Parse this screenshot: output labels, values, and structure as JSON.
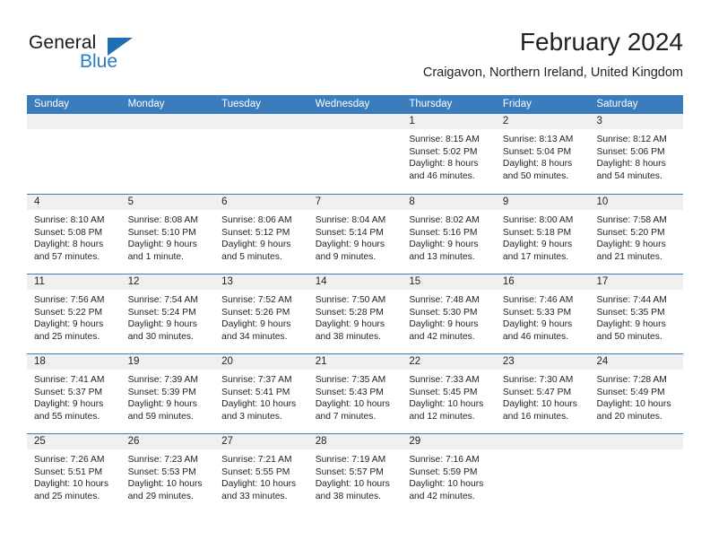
{
  "brand": {
    "name_top": "General",
    "name_bottom": "Blue",
    "accent_color": "#2b7cc4",
    "triangle_color": "#1f6fb5"
  },
  "header": {
    "month_title": "February 2024",
    "location": "Craigavon, Northern Ireland, United Kingdom"
  },
  "calendar": {
    "header_color": "#3b7cbd",
    "daynum_band_color": "#f0f0f0",
    "weekdays": [
      "Sunday",
      "Monday",
      "Tuesday",
      "Wednesday",
      "Thursday",
      "Friday",
      "Saturday"
    ],
    "weeks": [
      [
        {
          "day": "",
          "sunrise": "",
          "sunset": "",
          "daylight_line1": "",
          "daylight_line2": ""
        },
        {
          "day": "",
          "sunrise": "",
          "sunset": "",
          "daylight_line1": "",
          "daylight_line2": ""
        },
        {
          "day": "",
          "sunrise": "",
          "sunset": "",
          "daylight_line1": "",
          "daylight_line2": ""
        },
        {
          "day": "",
          "sunrise": "",
          "sunset": "",
          "daylight_line1": "",
          "daylight_line2": ""
        },
        {
          "day": "1",
          "sunrise": "Sunrise: 8:15 AM",
          "sunset": "Sunset: 5:02 PM",
          "daylight_line1": "Daylight: 8 hours",
          "daylight_line2": "and 46 minutes."
        },
        {
          "day": "2",
          "sunrise": "Sunrise: 8:13 AM",
          "sunset": "Sunset: 5:04 PM",
          "daylight_line1": "Daylight: 8 hours",
          "daylight_line2": "and 50 minutes."
        },
        {
          "day": "3",
          "sunrise": "Sunrise: 8:12 AM",
          "sunset": "Sunset: 5:06 PM",
          "daylight_line1": "Daylight: 8 hours",
          "daylight_line2": "and 54 minutes."
        }
      ],
      [
        {
          "day": "4",
          "sunrise": "Sunrise: 8:10 AM",
          "sunset": "Sunset: 5:08 PM",
          "daylight_line1": "Daylight: 8 hours",
          "daylight_line2": "and 57 minutes."
        },
        {
          "day": "5",
          "sunrise": "Sunrise: 8:08 AM",
          "sunset": "Sunset: 5:10 PM",
          "daylight_line1": "Daylight: 9 hours",
          "daylight_line2": "and 1 minute."
        },
        {
          "day": "6",
          "sunrise": "Sunrise: 8:06 AM",
          "sunset": "Sunset: 5:12 PM",
          "daylight_line1": "Daylight: 9 hours",
          "daylight_line2": "and 5 minutes."
        },
        {
          "day": "7",
          "sunrise": "Sunrise: 8:04 AM",
          "sunset": "Sunset: 5:14 PM",
          "daylight_line1": "Daylight: 9 hours",
          "daylight_line2": "and 9 minutes."
        },
        {
          "day": "8",
          "sunrise": "Sunrise: 8:02 AM",
          "sunset": "Sunset: 5:16 PM",
          "daylight_line1": "Daylight: 9 hours",
          "daylight_line2": "and 13 minutes."
        },
        {
          "day": "9",
          "sunrise": "Sunrise: 8:00 AM",
          "sunset": "Sunset: 5:18 PM",
          "daylight_line1": "Daylight: 9 hours",
          "daylight_line2": "and 17 minutes."
        },
        {
          "day": "10",
          "sunrise": "Sunrise: 7:58 AM",
          "sunset": "Sunset: 5:20 PM",
          "daylight_line1": "Daylight: 9 hours",
          "daylight_line2": "and 21 minutes."
        }
      ],
      [
        {
          "day": "11",
          "sunrise": "Sunrise: 7:56 AM",
          "sunset": "Sunset: 5:22 PM",
          "daylight_line1": "Daylight: 9 hours",
          "daylight_line2": "and 25 minutes."
        },
        {
          "day": "12",
          "sunrise": "Sunrise: 7:54 AM",
          "sunset": "Sunset: 5:24 PM",
          "daylight_line1": "Daylight: 9 hours",
          "daylight_line2": "and 30 minutes."
        },
        {
          "day": "13",
          "sunrise": "Sunrise: 7:52 AM",
          "sunset": "Sunset: 5:26 PM",
          "daylight_line1": "Daylight: 9 hours",
          "daylight_line2": "and 34 minutes."
        },
        {
          "day": "14",
          "sunrise": "Sunrise: 7:50 AM",
          "sunset": "Sunset: 5:28 PM",
          "daylight_line1": "Daylight: 9 hours",
          "daylight_line2": "and 38 minutes."
        },
        {
          "day": "15",
          "sunrise": "Sunrise: 7:48 AM",
          "sunset": "Sunset: 5:30 PM",
          "daylight_line1": "Daylight: 9 hours",
          "daylight_line2": "and 42 minutes."
        },
        {
          "day": "16",
          "sunrise": "Sunrise: 7:46 AM",
          "sunset": "Sunset: 5:33 PM",
          "daylight_line1": "Daylight: 9 hours",
          "daylight_line2": "and 46 minutes."
        },
        {
          "day": "17",
          "sunrise": "Sunrise: 7:44 AM",
          "sunset": "Sunset: 5:35 PM",
          "daylight_line1": "Daylight: 9 hours",
          "daylight_line2": "and 50 minutes."
        }
      ],
      [
        {
          "day": "18",
          "sunrise": "Sunrise: 7:41 AM",
          "sunset": "Sunset: 5:37 PM",
          "daylight_line1": "Daylight: 9 hours",
          "daylight_line2": "and 55 minutes."
        },
        {
          "day": "19",
          "sunrise": "Sunrise: 7:39 AM",
          "sunset": "Sunset: 5:39 PM",
          "daylight_line1": "Daylight: 9 hours",
          "daylight_line2": "and 59 minutes."
        },
        {
          "day": "20",
          "sunrise": "Sunrise: 7:37 AM",
          "sunset": "Sunset: 5:41 PM",
          "daylight_line1": "Daylight: 10 hours",
          "daylight_line2": "and 3 minutes."
        },
        {
          "day": "21",
          "sunrise": "Sunrise: 7:35 AM",
          "sunset": "Sunset: 5:43 PM",
          "daylight_line1": "Daylight: 10 hours",
          "daylight_line2": "and 7 minutes."
        },
        {
          "day": "22",
          "sunrise": "Sunrise: 7:33 AM",
          "sunset": "Sunset: 5:45 PM",
          "daylight_line1": "Daylight: 10 hours",
          "daylight_line2": "and 12 minutes."
        },
        {
          "day": "23",
          "sunrise": "Sunrise: 7:30 AM",
          "sunset": "Sunset: 5:47 PM",
          "daylight_line1": "Daylight: 10 hours",
          "daylight_line2": "and 16 minutes."
        },
        {
          "day": "24",
          "sunrise": "Sunrise: 7:28 AM",
          "sunset": "Sunset: 5:49 PM",
          "daylight_line1": "Daylight: 10 hours",
          "daylight_line2": "and 20 minutes."
        }
      ],
      [
        {
          "day": "25",
          "sunrise": "Sunrise: 7:26 AM",
          "sunset": "Sunset: 5:51 PM",
          "daylight_line1": "Daylight: 10 hours",
          "daylight_line2": "and 25 minutes."
        },
        {
          "day": "26",
          "sunrise": "Sunrise: 7:23 AM",
          "sunset": "Sunset: 5:53 PM",
          "daylight_line1": "Daylight: 10 hours",
          "daylight_line2": "and 29 minutes."
        },
        {
          "day": "27",
          "sunrise": "Sunrise: 7:21 AM",
          "sunset": "Sunset: 5:55 PM",
          "daylight_line1": "Daylight: 10 hours",
          "daylight_line2": "and 33 minutes."
        },
        {
          "day": "28",
          "sunrise": "Sunrise: 7:19 AM",
          "sunset": "Sunset: 5:57 PM",
          "daylight_line1": "Daylight: 10 hours",
          "daylight_line2": "and 38 minutes."
        },
        {
          "day": "29",
          "sunrise": "Sunrise: 7:16 AM",
          "sunset": "Sunset: 5:59 PM",
          "daylight_line1": "Daylight: 10 hours",
          "daylight_line2": "and 42 minutes."
        },
        {
          "day": "",
          "sunrise": "",
          "sunset": "",
          "daylight_line1": "",
          "daylight_line2": ""
        },
        {
          "day": "",
          "sunrise": "",
          "sunset": "",
          "daylight_line1": "",
          "daylight_line2": ""
        }
      ]
    ]
  }
}
